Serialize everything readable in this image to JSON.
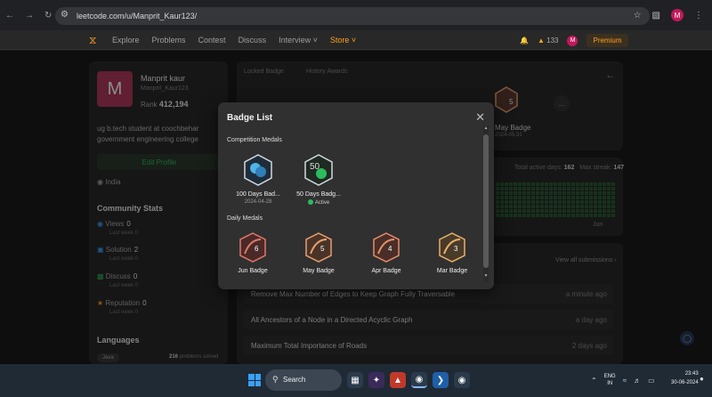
{
  "browser": {
    "url": "leetcode.com/u/Manprit_Kaur123/"
  },
  "nav": {
    "links": [
      "Explore",
      "Problems",
      "Contest",
      "Discuss",
      "Interview",
      "Store"
    ],
    "coins": "133",
    "avatar_letter": "M",
    "premium": "Premium"
  },
  "profile": {
    "avatar_letter": "M",
    "name": "Manprit kaur",
    "username": "Manprit_Kaur123",
    "rank_label": "Rank",
    "rank_value": "412,194",
    "bio": "ug b.tech student at coochbehar government engineering college",
    "edit_label": "Edit Profile",
    "location": "India",
    "community_title": "Community Stats",
    "stats": [
      {
        "label": "Views",
        "value": "0",
        "sub": "Last week 0"
      },
      {
        "label": "Solution",
        "value": "2",
        "sub": "Last week 0"
      },
      {
        "label": "Discuss",
        "value": "0",
        "sub": "Last week 0"
      },
      {
        "label": "Reputation",
        "value": "0",
        "sub": "Last week 0"
      }
    ],
    "languages_title": "Languages",
    "language": "Java",
    "language_solved": "216",
    "language_solved_suffix": "problems solved"
  },
  "badges_card": {
    "locked_tab": "Locked Badge",
    "history_tab": "History Awards",
    "may_label": "May Badge",
    "may_date": "2024-05-31",
    "more": "..."
  },
  "activity": {
    "active_days_label": "Total active days:",
    "active_days": "162",
    "max_streak_label": "Max streak:",
    "max_streak": "147",
    "month": "Jun"
  },
  "submissions": {
    "view_all": "View all submissions",
    "rows": [
      {
        "title": "Remove Max Number of Edges to Keep Graph Fully Traversable",
        "ago": "a minute ago"
      },
      {
        "title": "All Ancestors of a Node in a Directed Acyclic Graph",
        "ago": "a day ago"
      },
      {
        "title": "Maximum Total Importance of Roads",
        "ago": "2 days ago"
      }
    ]
  },
  "modal": {
    "title": "Badge List",
    "competition_title": "Competition Medals",
    "competition": [
      {
        "label": "100 Days Bad...",
        "date": "2024-04-28",
        "color": "#4fb3e8"
      },
      {
        "label": "50 Days Badg...",
        "date": "Active",
        "color": "#2cbb5d",
        "glyph": "50"
      }
    ],
    "daily_title": "Daily Medals",
    "daily": [
      {
        "label": "Jun Badge",
        "num": "6",
        "color": "#e0786a"
      },
      {
        "label": "May Badge",
        "num": "5",
        "color": "#e8a070"
      },
      {
        "label": "Apr Badge",
        "num": "4",
        "color": "#e88c6a"
      },
      {
        "label": "Mar Badge",
        "num": "3",
        "color": "#e6b06a"
      }
    ]
  },
  "taskbar": {
    "search": "Search",
    "lang_top": "ENG",
    "lang_bottom": "IN",
    "time": "23:43",
    "date": "30-06-2024"
  }
}
